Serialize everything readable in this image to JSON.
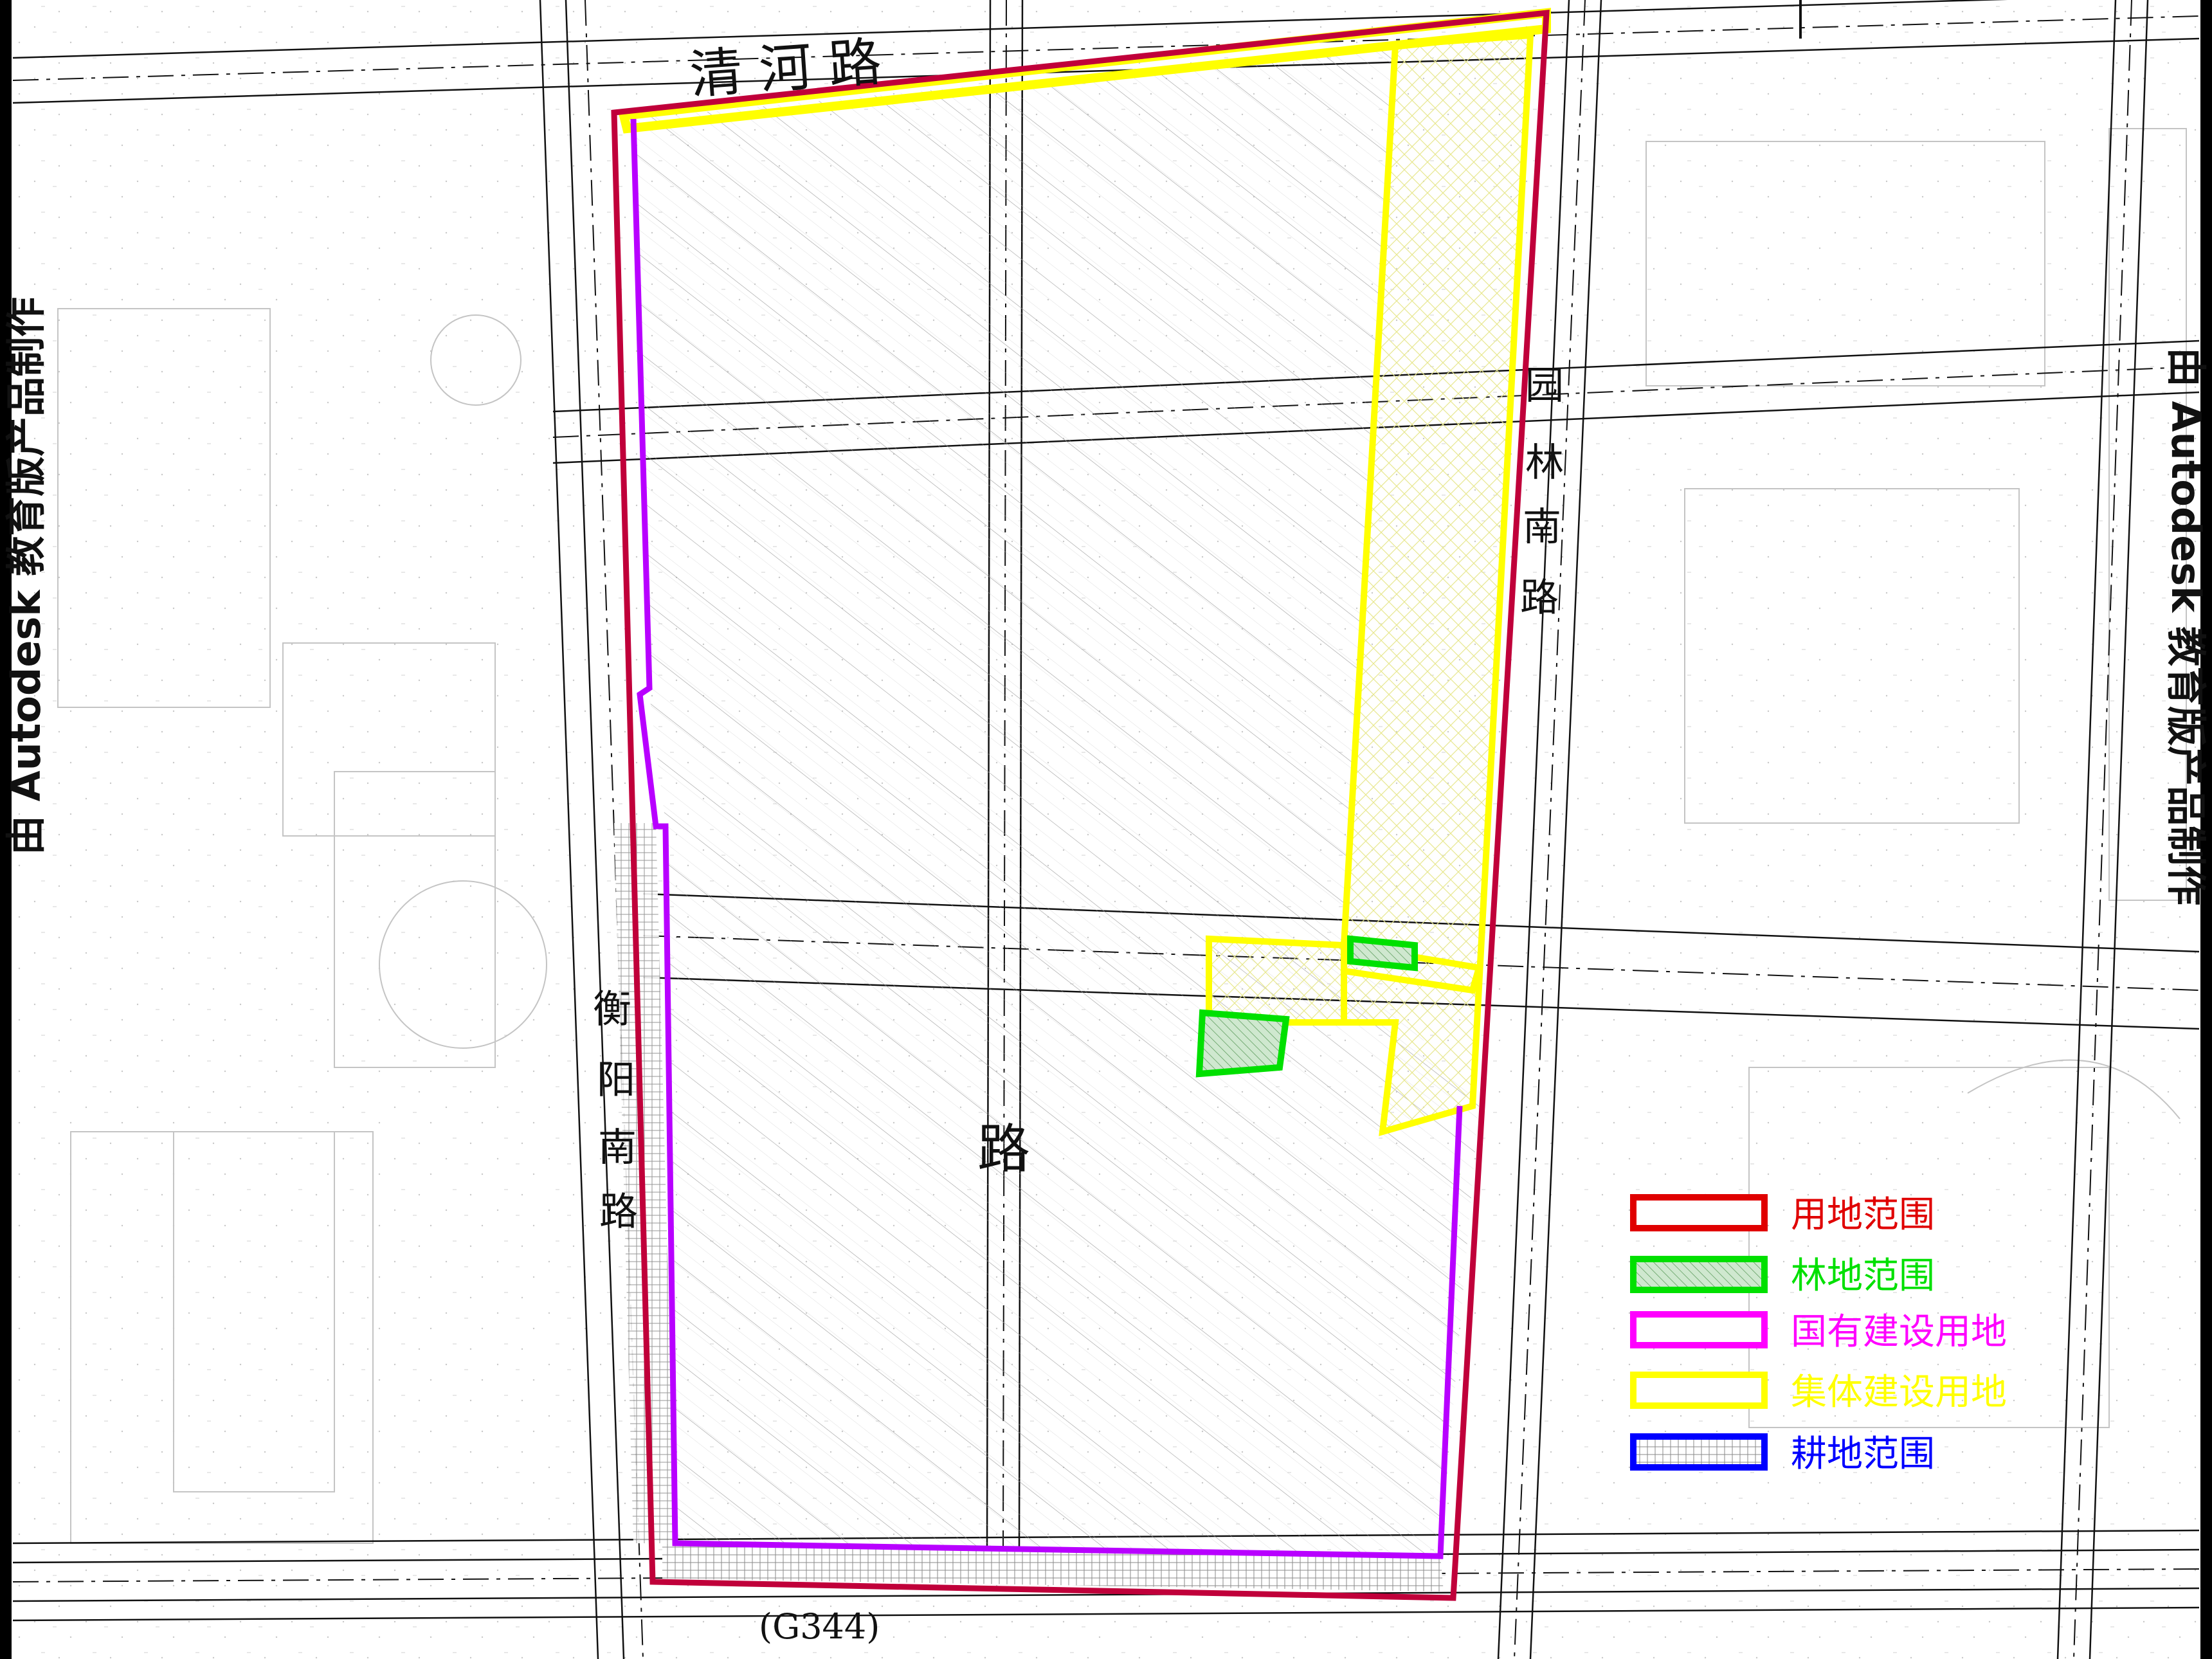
{
  "map": {
    "roads": {
      "qinghe": "清 河 路",
      "yuanlin_south": [
        "园",
        "林",
        "南",
        "路"
      ],
      "hengyang_south": [
        "衡",
        "阳",
        "南",
        "路"
      ],
      "center": "路",
      "g344": "(G344)"
    },
    "watermark_text": "由 Autodesk 教育版产品制作"
  },
  "legend": {
    "items": [
      {
        "key": "land_scope",
        "label": "用地范围",
        "color": "#e00000"
      },
      {
        "key": "forest_scope",
        "label": "林地范围",
        "color": "#00e000"
      },
      {
        "key": "state_owned",
        "label": "国有建设用地",
        "color": "#ff00ff"
      },
      {
        "key": "collective",
        "label": "集体建设用地",
        "color": "#ffff00"
      },
      {
        "key": "farmland",
        "label": "耕地范围",
        "color": "#0000ff"
      }
    ]
  },
  "colors": {
    "boundary_red": "#c0003a",
    "state_magenta": "#b800ff",
    "collective_yellow": "#ffff00",
    "forest_green": "#00e000",
    "farmland_blue": "#0000ff",
    "base_line": "#111111",
    "base_faint": "#bdbdbd"
  }
}
